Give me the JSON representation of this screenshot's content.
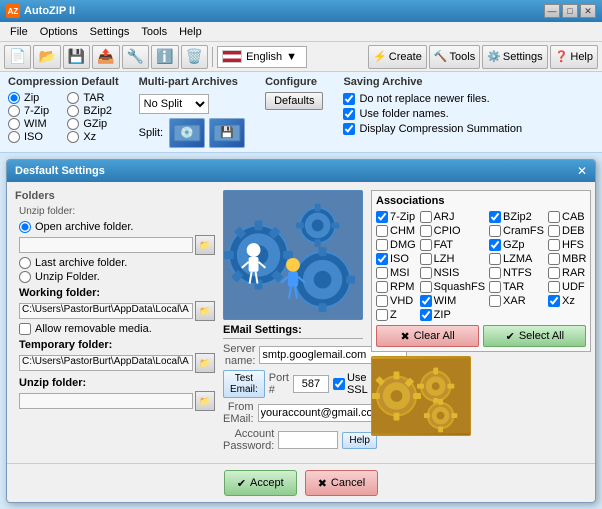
{
  "app": {
    "title": "AutoZIP II",
    "icon_label": "AZ"
  },
  "title_bar": {
    "controls": [
      "—",
      "□",
      "✕"
    ]
  },
  "menu": {
    "items": [
      "File",
      "Options",
      "Settings",
      "Tools",
      "Help"
    ]
  },
  "toolbar": {
    "buttons": [
      "New",
      "Open",
      "Save",
      "Extract",
      "Test"
    ],
    "language": "English"
  },
  "top_bar": {
    "compression_title": "Compression Default",
    "compression_options": [
      "Zip",
      "TAR",
      "7-Zip",
      "BZip2",
      "WIM",
      "GZip",
      "ISO",
      "Xz"
    ],
    "multipart_title": "Multi-part Archives",
    "split_label": "Split:",
    "configure_title": "Configure",
    "defaults_label": "Defaults",
    "saving_title": "Saving Archive",
    "saving_options": [
      "Do not replace newer files.",
      "Use folder names.",
      "Display Compression Summation"
    ]
  },
  "dialog": {
    "title": "Desfault Settings",
    "close_label": "✕",
    "folders_label": "Folders",
    "unzip_folder_label": "Unzip folder:",
    "open_archive_radio": "Open archive folder.",
    "last_archive_radio": "Last archive folder.",
    "unzip_folder_radio": "Unzip Folder.",
    "working_folder_label": "Working folder:",
    "working_path": "C:\\Users\\PastorBurt\\AppData\\Local\\A",
    "allow_removable": "Allow removable media.",
    "temp_folder_label": "Temporary folder:",
    "temp_path": "C:\\Users\\PastorBurt\\AppData\\Local\\A",
    "unzip_sub_label": "Unzip folder:",
    "associations_title": "Associations",
    "assoc_items": [
      {
        "label": "7-Zip",
        "checked": true
      },
      {
        "label": "ARJ",
        "checked": false
      },
      {
        "label": "BZip2",
        "checked": true
      },
      {
        "label": "CAB",
        "checked": false
      },
      {
        "label": "CHM",
        "checked": false
      },
      {
        "label": "CPIO",
        "checked": false
      },
      {
        "label": "CramFS",
        "checked": false
      },
      {
        "label": "DEB",
        "checked": false
      },
      {
        "label": "DMG",
        "checked": false
      },
      {
        "label": "FAT",
        "checked": false
      },
      {
        "label": "GZp",
        "checked": true
      },
      {
        "label": "HFS",
        "checked": false
      },
      {
        "label": "ISO",
        "checked": true
      },
      {
        "label": "LZH",
        "checked": false
      },
      {
        "label": "LZMA",
        "checked": false
      },
      {
        "label": "MBR",
        "checked": false
      },
      {
        "label": "MSI",
        "checked": false
      },
      {
        "label": "NSIS",
        "checked": false
      },
      {
        "label": "NTFS",
        "checked": false
      },
      {
        "label": "RAR",
        "checked": false
      },
      {
        "label": "RPM",
        "checked": false
      },
      {
        "label": "SquashFS",
        "checked": false
      },
      {
        "label": "TAR",
        "checked": false
      },
      {
        "label": "UDF",
        "checked": false
      },
      {
        "label": "VHD",
        "checked": false
      },
      {
        "label": "WIM",
        "checked": true
      },
      {
        "label": "XAR",
        "checked": false
      },
      {
        "label": "Xz",
        "checked": true
      },
      {
        "label": "Z",
        "checked": false
      },
      {
        "label": "ZIP",
        "checked": true
      }
    ],
    "clear_all_label": "Clear All",
    "select_all_label": "Select All",
    "email_title": "EMail Settings:",
    "server_label": "Server name:",
    "server_value": "smtp.googlemail.com",
    "test_email_label": "Test Email:",
    "port_label": "Port #",
    "port_value": "587",
    "use_ssl_label": "Use SSL",
    "from_email_label": "From EMail:",
    "from_email_value": "youraccount@gmail.com",
    "password_label": "Account Password:",
    "help_label": "Help",
    "accept_label": "Accept",
    "cancel_label": "Cancel"
  }
}
